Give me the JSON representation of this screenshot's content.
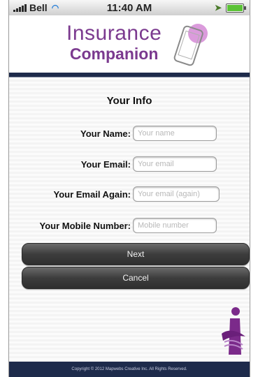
{
  "status_bar": {
    "carrier": "Bell",
    "time": "11:40 AM",
    "icons": [
      "signal-icon",
      "wifi-icon",
      "location-icon",
      "battery-icon"
    ]
  },
  "header": {
    "logo_line1": "Insurance",
    "logo_line2": "Companion",
    "logo_icon": "phone-icon"
  },
  "form": {
    "title": "Your Info",
    "fields": [
      {
        "label": "Your Name:",
        "placeholder": "Your name",
        "value": ""
      },
      {
        "label": "Your Email:",
        "placeholder": "Your email",
        "value": ""
      },
      {
        "label": "Your Email Again:",
        "placeholder": "Your email (again)",
        "value": ""
      },
      {
        "label": "Your Mobile Number:",
        "placeholder": "Mobile number",
        "value": ""
      }
    ],
    "next_label": "Next",
    "cancel_label": "Cancel"
  },
  "footer": {
    "copyright": "Copyright © 2012 Mapwebs Creative Inc. All Rights Reserved."
  },
  "colors": {
    "brand_purple": "#7b3a8f",
    "navy": "#1e2b4b",
    "button_dark": "#3d3d3d"
  }
}
